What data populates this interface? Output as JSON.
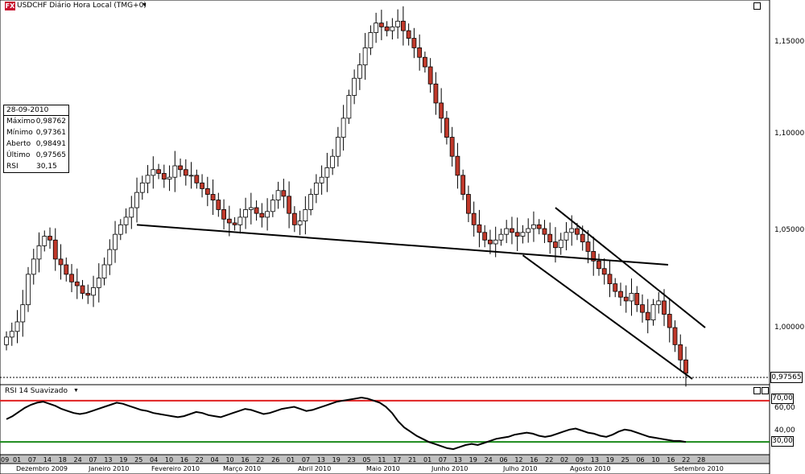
{
  "window": {
    "symbol_logo": "FX",
    "title": "USDCHF Diário Hora Local (TMG+0)"
  },
  "info_panel": {
    "date": "28-09-2010",
    "rows": [
      {
        "label": "Máximo",
        "value": "0,98762"
      },
      {
        "label": "Mínimo",
        "value": "0,97361"
      },
      {
        "label": "Aberto",
        "value": "0,98491"
      },
      {
        "label": "Último",
        "value": "0,97565"
      },
      {
        "label": "RSI",
        "value": "30,15"
      }
    ]
  },
  "price_axis": {
    "ticks": [
      "1,15000",
      "1,10000",
      "1,05000",
      "1,00000"
    ],
    "last_price": "0,97565"
  },
  "rsi_panel": {
    "title": "RSI 14 Suavizado",
    "ticks": [
      "70,00",
      "60,00",
      "40,00",
      "30,00"
    ]
  },
  "x_axis": {
    "first_day": "09",
    "days": [
      "01",
      "07",
      "14",
      "18",
      "24",
      "07",
      "13",
      "19",
      "25",
      "04",
      "10",
      "16",
      "22",
      "04",
      "10",
      "16",
      "22",
      "26",
      "01",
      "07",
      "13",
      "19",
      "23",
      "05",
      "11",
      "17",
      "21",
      "01",
      "07",
      "13",
      "19",
      "24",
      "06",
      "12",
      "16",
      "22",
      "02",
      "09",
      "13",
      "19",
      "25",
      "06",
      "10",
      "16",
      "22",
      "28"
    ],
    "months": [
      "Dezembro 2009",
      "Janeiro 2010",
      "Fevereiro 2010",
      "Março 2010",
      "Abril 2010",
      "Maio 2010",
      "Junho 2010",
      "Julho 2010",
      "Agosto 2010",
      "Setembro 2010"
    ]
  },
  "colors": {
    "candle_up": "#ffffff",
    "candle_down": "#c0392b",
    "overbought_line": "#e02020",
    "oversold_line": "#1a8a1a",
    "trend_line": "#000000",
    "grid_bar": "#c0c0c0"
  },
  "chart_data": {
    "type": "candlestick",
    "instrument": "USDCHF",
    "timeframe": "Diário",
    "ylim": [
      0.97,
      1.17
    ],
    "rsi_ylim": [
      20,
      80
    ],
    "rsi_levels": [
      70,
      30
    ],
    "series_close": [
      0.995,
      0.998,
      1.003,
      1.012,
      1.028,
      1.036,
      1.043,
      1.048,
      1.046,
      1.036,
      1.033,
      1.028,
      1.024,
      1.022,
      1.018,
      1.017,
      1.021,
      1.026,
      1.033,
      1.041,
      1.049,
      1.054,
      1.058,
      1.063,
      1.071,
      1.076,
      1.08,
      1.083,
      1.081,
      1.078,
      1.079,
      1.085,
      1.083,
      1.08,
      1.08,
      1.076,
      1.073,
      1.07,
      1.067,
      1.062,
      1.057,
      1.055,
      1.054,
      1.058,
      1.062,
      1.063,
      1.06,
      1.058,
      1.061,
      1.067,
      1.072,
      1.069,
      1.06,
      1.054,
      1.056,
      1.062,
      1.07,
      1.076,
      1.079,
      1.084,
      1.09,
      1.1,
      1.11,
      1.122,
      1.131,
      1.138,
      1.147,
      1.155,
      1.16,
      1.158,
      1.156,
      1.158,
      1.161,
      1.156,
      1.152,
      1.147,
      1.142,
      1.137,
      1.128,
      1.118,
      1.11,
      1.1,
      1.09,
      1.08,
      1.07,
      1.06,
      1.054,
      1.05,
      1.046,
      1.044,
      1.046,
      1.049,
      1.052,
      1.05,
      1.048,
      1.05,
      1.052,
      1.054,
      1.052,
      1.049,
      1.045,
      1.042,
      1.046,
      1.05,
      1.052,
      1.049,
      1.045,
      1.04,
      1.035,
      1.031,
      1.028,
      1.023,
      1.019,
      1.016,
      1.014,
      1.018,
      1.012,
      1.008,
      1.004,
      1.012,
      1.014,
      1.007,
      1.0,
      0.991,
      0.983,
      0.976
    ],
    "rsi": [
      52,
      55,
      59,
      63,
      66,
      68,
      69,
      67,
      65,
      62,
      60,
      58,
      57,
      58,
      60,
      62,
      64,
      66,
      68,
      67,
      65,
      63,
      61,
      60,
      58,
      57,
      56,
      55,
      54,
      55,
      57,
      59,
      58,
      56,
      55,
      54,
      56,
      58,
      60,
      62,
      61,
      59,
      57,
      58,
      60,
      62,
      63,
      64,
      62,
      60,
      61,
      63,
      65,
      67,
      69,
      70,
      71,
      72,
      73,
      72,
      70,
      68,
      64,
      58,
      50,
      44,
      40,
      36,
      33,
      30,
      28,
      26,
      24,
      23,
      25,
      27,
      28,
      27,
      29,
      31,
      33,
      34,
      35,
      37,
      38,
      39,
      38,
      36,
      35,
      36,
      38,
      40,
      42,
      43,
      41,
      39,
      38,
      36,
      35,
      37,
      40,
      42,
      41,
      39,
      37,
      35,
      34,
      33,
      32,
      31,
      31,
      30
    ],
    "annotations": [
      {
        "type": "trend_line",
        "from": [
          "2010-02-01",
          1.054
        ],
        "to": [
          "2010-08-30",
          1.033
        ]
      },
      {
        "type": "channel_upper",
        "from": [
          "2010-08-09",
          1.063
        ],
        "to": [
          "2010-09-30",
          1.0
        ]
      },
      {
        "type": "channel_lower",
        "from": [
          "2010-07-30",
          1.038
        ],
        "to": [
          "2010-09-28",
          0.973
        ]
      }
    ]
  }
}
